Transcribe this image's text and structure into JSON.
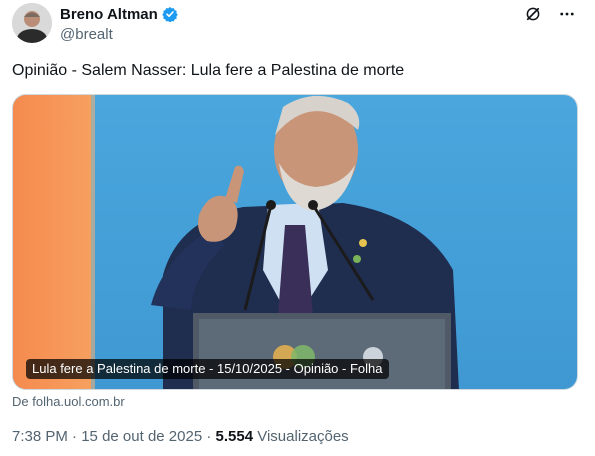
{
  "author": {
    "name": "Breno Altman",
    "handle": "@brealt",
    "verified": true
  },
  "tweet": {
    "text": "Opinião - Salem Nasser: Lula fere a Palestina de morte"
  },
  "card": {
    "caption": "Lula fere a Palestina de morte - 15/10/2025 - Opinião - Folha",
    "source": "De folha.uol.com.br",
    "image_description_icon": "photo-of-speaker-at-podium"
  },
  "meta": {
    "time": "7:38 PM",
    "separator1": " · ",
    "date": "15 de out de 2025",
    "separator2": " · ",
    "views": "5.554",
    "views_label": " Visualizações"
  },
  "colors": {
    "verified_blue": "#1d9bf0",
    "secondary_text": "#536471",
    "primary_text": "#0f1419"
  },
  "icons": {
    "grok": "grok-icon",
    "more": "more-icon"
  }
}
